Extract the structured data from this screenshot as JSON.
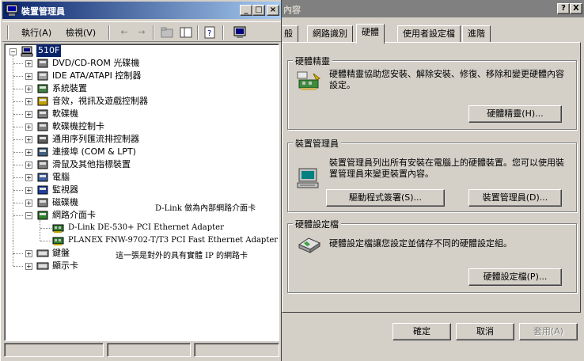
{
  "props": {
    "title": "內容",
    "tabs": [
      "般",
      "網路識別",
      "硬體",
      "使用者設定檔",
      "進階"
    ],
    "groups": {
      "wizard": {
        "title": "硬體精靈",
        "text": "硬體精靈協助您安裝、解除安裝、修復、移除和變更硬體內容設定。",
        "button": "硬體精靈(H)..."
      },
      "devmgr": {
        "title": "裝置管理員",
        "text": "裝置管理員列出所有安裝在電腦上的硬體裝置。您可以使用裝置管理員來變更裝置內容。",
        "button1": "驅動程式簽署(S)...",
        "button2": "裝置管理員(D)..."
      },
      "profiles": {
        "title": "硬體設定檔",
        "text": "硬體設定檔讓您設定並儲存不同的硬體設定組。",
        "button": "硬體設定檔(P)..."
      }
    },
    "ok": "確定",
    "cancel": "取消",
    "apply": "套用(A)",
    "help_btn": "?",
    "close_btn": "X"
  },
  "devmgr": {
    "title": "裝置管理員",
    "menu": {
      "action": "執行(A)",
      "view": "檢視(V)"
    },
    "root": "510F",
    "categories": [
      "DVD/CD-ROM 光碟機",
      "IDE ATA/ATAPI 控制器",
      "系統裝置",
      "音效，視訊及遊戲控制器",
      "軟碟機",
      "軟碟機控制卡",
      "通用序列匯流排控制器",
      "連接埠 (COM & LPT)",
      "滑鼠及其他指標裝置",
      "電腦",
      "監視器",
      "磁碟機",
      "網路介面卡"
    ],
    "adapters": [
      "D-Link DE-530+ PCI Ethernet Adapter",
      "PLANEX FNW-9702-T/T3 PCI Fast Ethernet Adapter"
    ],
    "after": [
      "鍵盤",
      "顯示卡"
    ],
    "notes": {
      "dlink": "D-Link  做為內部網路介面卡",
      "planex": "這一張是對外的具有實體 IP 的網路卡"
    }
  }
}
